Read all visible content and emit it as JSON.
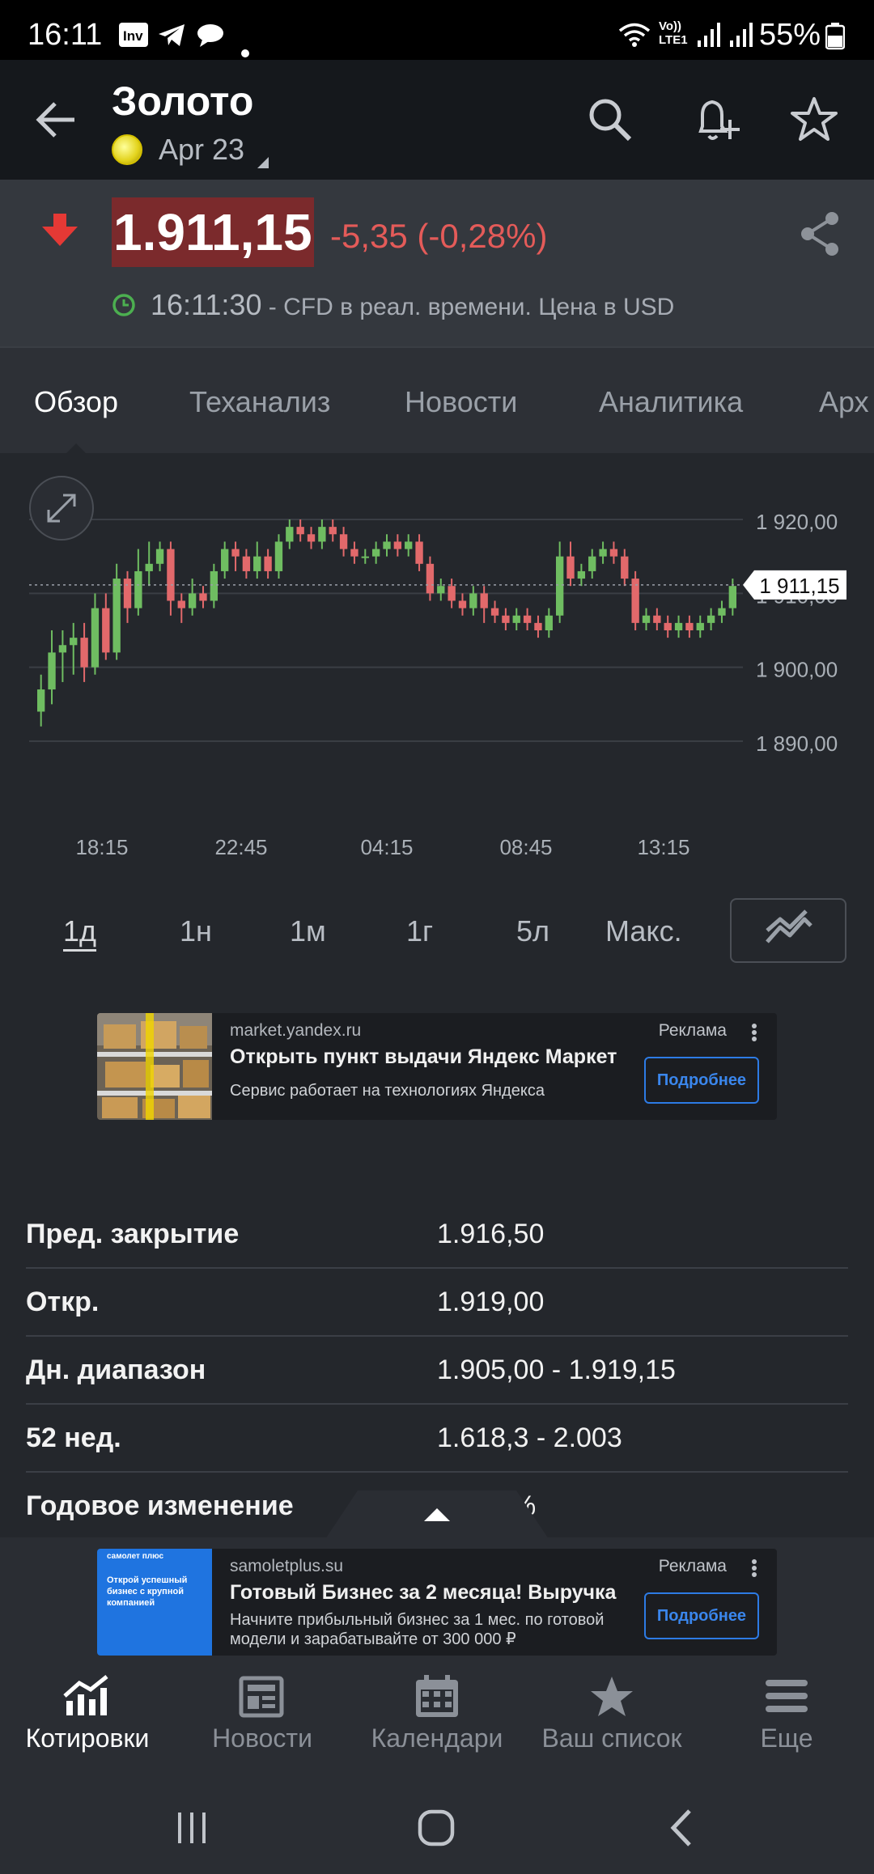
{
  "status_bar": {
    "time": "16:11",
    "network_label": "Vo)) LTE1",
    "battery": "55%"
  },
  "header": {
    "title": "Золото",
    "contract": "Apr 23"
  },
  "quote": {
    "price": "1.911,15",
    "change": "-5,35 (-0,28%)",
    "time": "16:11:30",
    "time_note": " - CFD в реал. времени. Цена в USD",
    "colors": {
      "down": "#e45b59",
      "price_bg": "#7b2a2c",
      "live": "#4caf50"
    }
  },
  "tabs": [
    {
      "label": "Обзор"
    },
    {
      "label": "Теханализ"
    },
    {
      "label": "Новости"
    },
    {
      "label": "Аналитика"
    },
    {
      "label": "Арх"
    }
  ],
  "chart_data": {
    "type": "candlestick",
    "x_ticks": [
      "18:15",
      "22:45",
      "04:15",
      "08:45",
      "13:15"
    ],
    "y_ticks": [
      "1 920,00",
      "1 910,00",
      "1 900,00",
      "1 890,00"
    ],
    "ylim": [
      1890,
      1920
    ],
    "current_value_label": "1 911,15",
    "current_value": 1911.15,
    "colors": {
      "up": "#6fbd61",
      "down": "#e2696b",
      "grid": "#3a3e44"
    },
    "candles": [
      [
        1894,
        1897,
        1892,
        1899
      ],
      [
        1897,
        1902,
        1895,
        1905
      ],
      [
        1902,
        1903,
        1898,
        1905
      ],
      [
        1903,
        1904,
        1899,
        1906
      ],
      [
        1904,
        1900,
        1898,
        1906
      ],
      [
        1900,
        1908,
        1899,
        1910
      ],
      [
        1908,
        1902,
        1901,
        1910
      ],
      [
        1902,
        1912,
        1901,
        1914
      ],
      [
        1912,
        1908,
        1906,
        1913
      ],
      [
        1908,
        1913,
        1907,
        1916
      ],
      [
        1913,
        1914,
        1911,
        1917
      ],
      [
        1914,
        1916,
        1913,
        1917
      ],
      [
        1916,
        1909,
        1907,
        1917
      ],
      [
        1909,
        1908,
        1906,
        1910
      ],
      [
        1908,
        1910,
        1907,
        1912
      ],
      [
        1910,
        1909,
        1908,
        1911
      ],
      [
        1909,
        1913,
        1908,
        1914
      ],
      [
        1913,
        1916,
        1912,
        1917
      ],
      [
        1916,
        1915,
        1913,
        1917
      ],
      [
        1915,
        1913,
        1912,
        1916
      ],
      [
        1913,
        1915,
        1912,
        1917
      ],
      [
        1915,
        1913,
        1912,
        1916
      ],
      [
        1913,
        1917,
        1912,
        1918
      ],
      [
        1917,
        1919,
        1916,
        1920
      ],
      [
        1919,
        1918,
        1917,
        1920
      ],
      [
        1918,
        1917,
        1916,
        1919
      ],
      [
        1917,
        1919,
        1916,
        1920
      ],
      [
        1919,
        1918,
        1917,
        1920
      ],
      [
        1918,
        1916,
        1915,
        1919
      ],
      [
        1916,
        1915,
        1914,
        1917
      ],
      [
        1915,
        1915,
        1914,
        1916
      ],
      [
        1915,
        1916,
        1914,
        1917
      ],
      [
        1916,
        1917,
        1915,
        1918
      ],
      [
        1917,
        1916,
        1915,
        1918
      ],
      [
        1916,
        1917,
        1915,
        1918
      ],
      [
        1917,
        1914,
        1913,
        1918
      ],
      [
        1914,
        1910,
        1909,
        1915
      ],
      [
        1910,
        1911,
        1909,
        1912
      ],
      [
        1911,
        1909,
        1908,
        1912
      ],
      [
        1909,
        1908,
        1907,
        1910
      ],
      [
        1908,
        1910,
        1907,
        1911
      ],
      [
        1910,
        1908,
        1906,
        1911
      ],
      [
        1908,
        1907,
        1906,
        1909
      ],
      [
        1907,
        1906,
        1905,
        1908
      ],
      [
        1906,
        1907,
        1905,
        1908
      ],
      [
        1907,
        1906,
        1905,
        1908
      ],
      [
        1906,
        1905,
        1904,
        1907
      ],
      [
        1905,
        1907,
        1904,
        1908
      ],
      [
        1907,
        1915,
        1906,
        1917
      ],
      [
        1915,
        1912,
        1911,
        1917
      ],
      [
        1912,
        1913,
        1911,
        1914
      ],
      [
        1913,
        1915,
        1912,
        1916
      ],
      [
        1915,
        1916,
        1914,
        1917
      ],
      [
        1916,
        1915,
        1914,
        1917
      ],
      [
        1915,
        1912,
        1911,
        1916
      ],
      [
        1912,
        1906,
        1905,
        1913
      ],
      [
        1906,
        1907,
        1905,
        1908
      ],
      [
        1907,
        1906,
        1905,
        1908
      ],
      [
        1906,
        1905,
        1904,
        1907
      ],
      [
        1905,
        1906,
        1904,
        1907
      ],
      [
        1906,
        1905,
        1904,
        1907
      ],
      [
        1905,
        1906,
        1904,
        1907
      ],
      [
        1906,
        1907,
        1905,
        1908
      ],
      [
        1907,
        1908,
        1906,
        1909
      ],
      [
        1908,
        1911,
        1907,
        1912
      ]
    ]
  },
  "ranges": [
    "1д",
    "1н",
    "1м",
    "1г",
    "5л",
    "Макс."
  ],
  "ads": [
    {
      "domain": "market.yandex.ru",
      "title": "Открыть пункт выдачи Яндекс Маркет",
      "desc": "Сервис работает на технологиях Яндекса",
      "tag": "Реклама",
      "button": "Подробнее"
    },
    {
      "domain": "samoletplus.su",
      "title": "Готовый Бизнес за 2 месяца! Выручка",
      "desc": "Начните прибыльный бизнес за 1 мес. по готовой модели и зарабатывайте от 300 000 ₽",
      "tag": "Реклама",
      "button": "Подробнее",
      "image_text": "Открой успешный бизнес с крупной компанией",
      "image_brand": "самолет плюс"
    }
  ],
  "stats": [
    {
      "label": "Пред. закрытие",
      "value": "1.916,50"
    },
    {
      "label": "Откр.",
      "value": "1.919,00"
    },
    {
      "label": "Дн. диапазон",
      "value": "1.905,00 - 1.919,15"
    },
    {
      "label": "52 нед.",
      "value": "1.618,3 - 2.003"
    },
    {
      "label": "Годовое изменение",
      "value": "%"
    }
  ],
  "bottom_nav": [
    {
      "label": "Котировки",
      "icon": "chart-icon"
    },
    {
      "label": "Новости",
      "icon": "newspaper-icon"
    },
    {
      "label": "Календари",
      "icon": "calendar-icon"
    },
    {
      "label": "Ваш список",
      "icon": "star-icon"
    },
    {
      "label": "Еще",
      "icon": "menu-icon"
    }
  ]
}
